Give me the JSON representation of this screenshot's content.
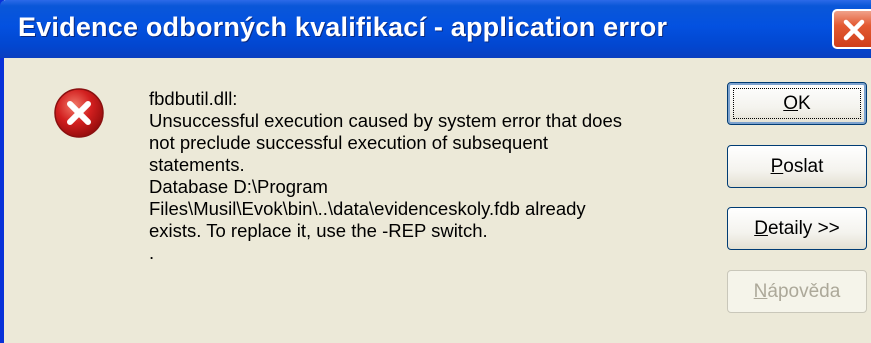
{
  "window": {
    "title": "Evidence odborných kvalifikací - application error",
    "close_icon": "close-icon"
  },
  "dialog": {
    "icon": "error-icon",
    "message_lines": [
      "fbdbutil.dll:",
      "Unsuccessful execution caused by system error that does",
      "not preclude successful execution of subsequent",
      "statements.",
      "Database D:\\Program",
      "Files\\Musil\\Evok\\bin\\..\\data\\evidenceskoly.fdb already",
      "exists.  To replace it, use the -REP switch.",
      "."
    ]
  },
  "buttons": {
    "ok": {
      "accel": "O",
      "rest": "K"
    },
    "send": {
      "accel": "P",
      "rest": "oslat"
    },
    "details": {
      "accel": "D",
      "rest": "etaily >>"
    },
    "help": {
      "accel": "N",
      "rest": "ápověda",
      "enabled": false
    }
  },
  "colors": {
    "titlebar": "#0351E0",
    "dialog_bg": "#ECE9D8",
    "close_button": "#E35A32",
    "error_icon": "#D21F1F",
    "button_border": "#003C74",
    "disabled_text": "#ACA899"
  }
}
